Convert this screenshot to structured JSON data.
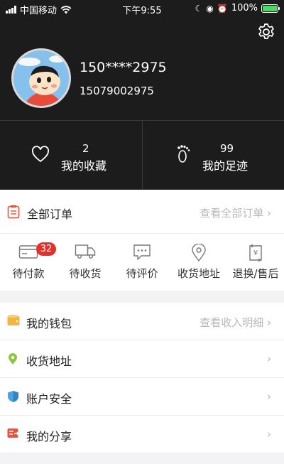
{
  "status_bar": {
    "carrier": "中国移动",
    "time": "下午9:55",
    "battery": "100%"
  },
  "profile": {
    "masked_phone": "150****2975",
    "phone": "15079002975"
  },
  "stats": [
    {
      "count": "2",
      "label": "我的收藏",
      "icon": "heart-icon"
    },
    {
      "count": "99",
      "label": "我的足迹",
      "icon": "footprint-icon"
    }
  ],
  "orders": {
    "title": "全部订单",
    "view_all": "查看全部订单",
    "items": [
      {
        "label": "待付款",
        "icon": "wallet-icon",
        "badge": "32"
      },
      {
        "label": "待收货",
        "icon": "truck-icon"
      },
      {
        "label": "待评价",
        "icon": "comment-icon"
      },
      {
        "label": "收货地址",
        "icon": "location-icon"
      },
      {
        "label": "退换/售后",
        "icon": "refund-icon"
      }
    ]
  },
  "menu": [
    {
      "label": "我的钱包",
      "right": "查看收入明细",
      "icon": "wallet-icon",
      "color": "#f2b640"
    },
    {
      "label": "收货地址",
      "right": "",
      "icon": "location-icon",
      "color": "#8cc63f"
    },
    {
      "label": "账户安全",
      "right": "",
      "icon": "shield-icon",
      "color": "#4da3e0"
    },
    {
      "label": "我的分享",
      "right": "",
      "icon": "share-icon",
      "color": "#e8533d"
    }
  ]
}
